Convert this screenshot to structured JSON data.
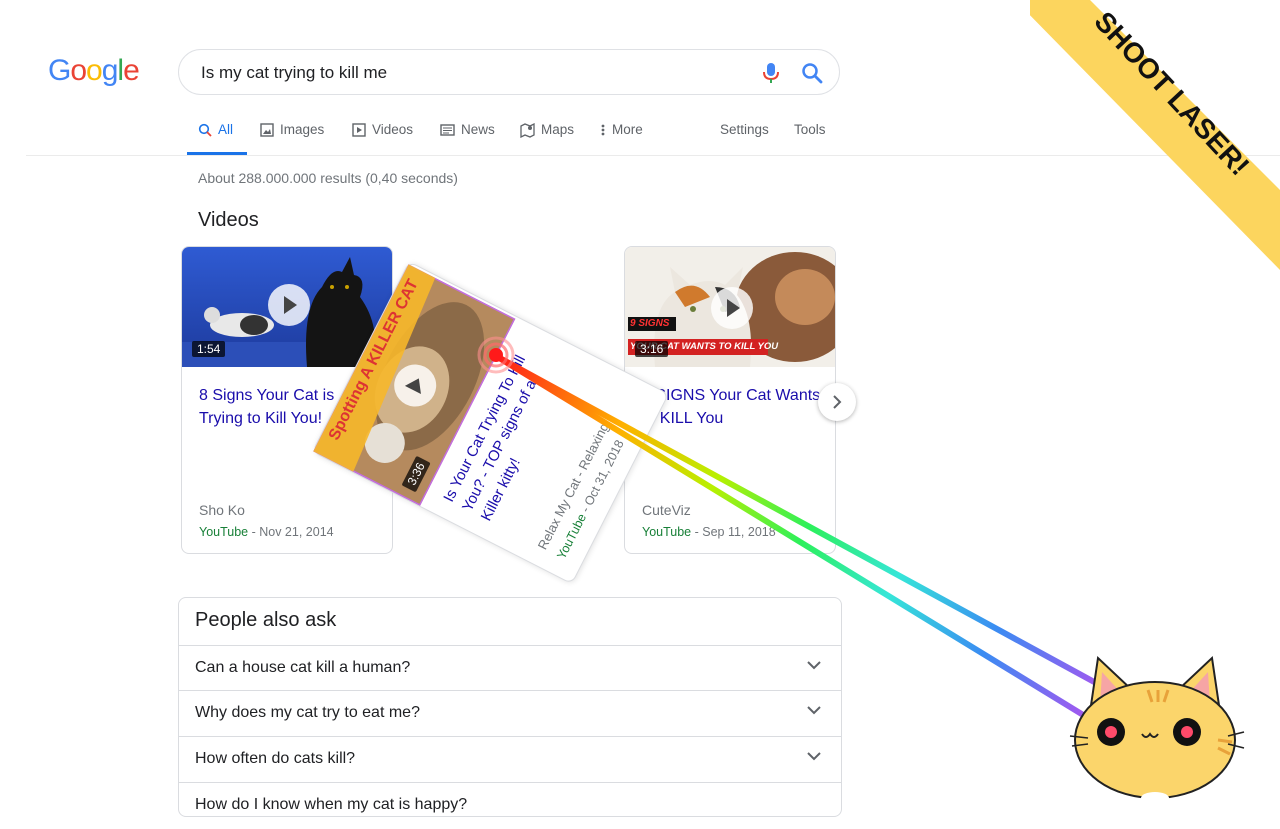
{
  "header": {
    "logo": "Google",
    "search_query": "Is my cat trying to kill me"
  },
  "tabs": [
    {
      "label": "All",
      "active": true
    },
    {
      "label": "Images"
    },
    {
      "label": "Videos"
    },
    {
      "label": "News"
    },
    {
      "label": "Maps"
    },
    {
      "label": "More"
    }
  ],
  "tools": {
    "settings": "Settings",
    "tools": "Tools"
  },
  "result_stats": "About 288.000.000 results (0,40 seconds)",
  "videos": {
    "heading": "Videos",
    "cards": [
      {
        "duration": "1:54",
        "title": "8 Signs Your Cat is Trying to Kill You!",
        "channel": "Sho Ko",
        "source": "YouTube",
        "date": " - Nov 21, 2014"
      },
      {
        "duration": "3:36",
        "title": "Is Your Cat Trying To Kill You? - TOP signs of a Killer kitty!",
        "channel": "Relax My Cat - Relaxing...",
        "source": "YouTube",
        "date": " - Oct 31, 2018",
        "thumb_text": "Spotting A KILLER CAT"
      },
      {
        "duration": "3:16",
        "title": "9 SIGNS Your Cat Wants to KILL You",
        "channel": "CuteViz",
        "source": "YouTube",
        "date": " - Sep 11, 2018",
        "thumb_text_top": "9 SIGNS",
        "thumb_text_bottom": "YOUR CAT WANTS TO KILL YOU"
      }
    ]
  },
  "people_also_ask": {
    "heading": "People also ask",
    "questions": [
      "Can a house cat kill a human?",
      "Why does my cat try to eat me?",
      "How often do cats kill?",
      "How do I know when my cat is happy?"
    ]
  },
  "ribbon": {
    "text": "SHOOT LASER!",
    "color": "#fcd55e"
  },
  "colors": {
    "link": "#1a0dab",
    "accent": "#1a73e8",
    "green": "#188038"
  }
}
